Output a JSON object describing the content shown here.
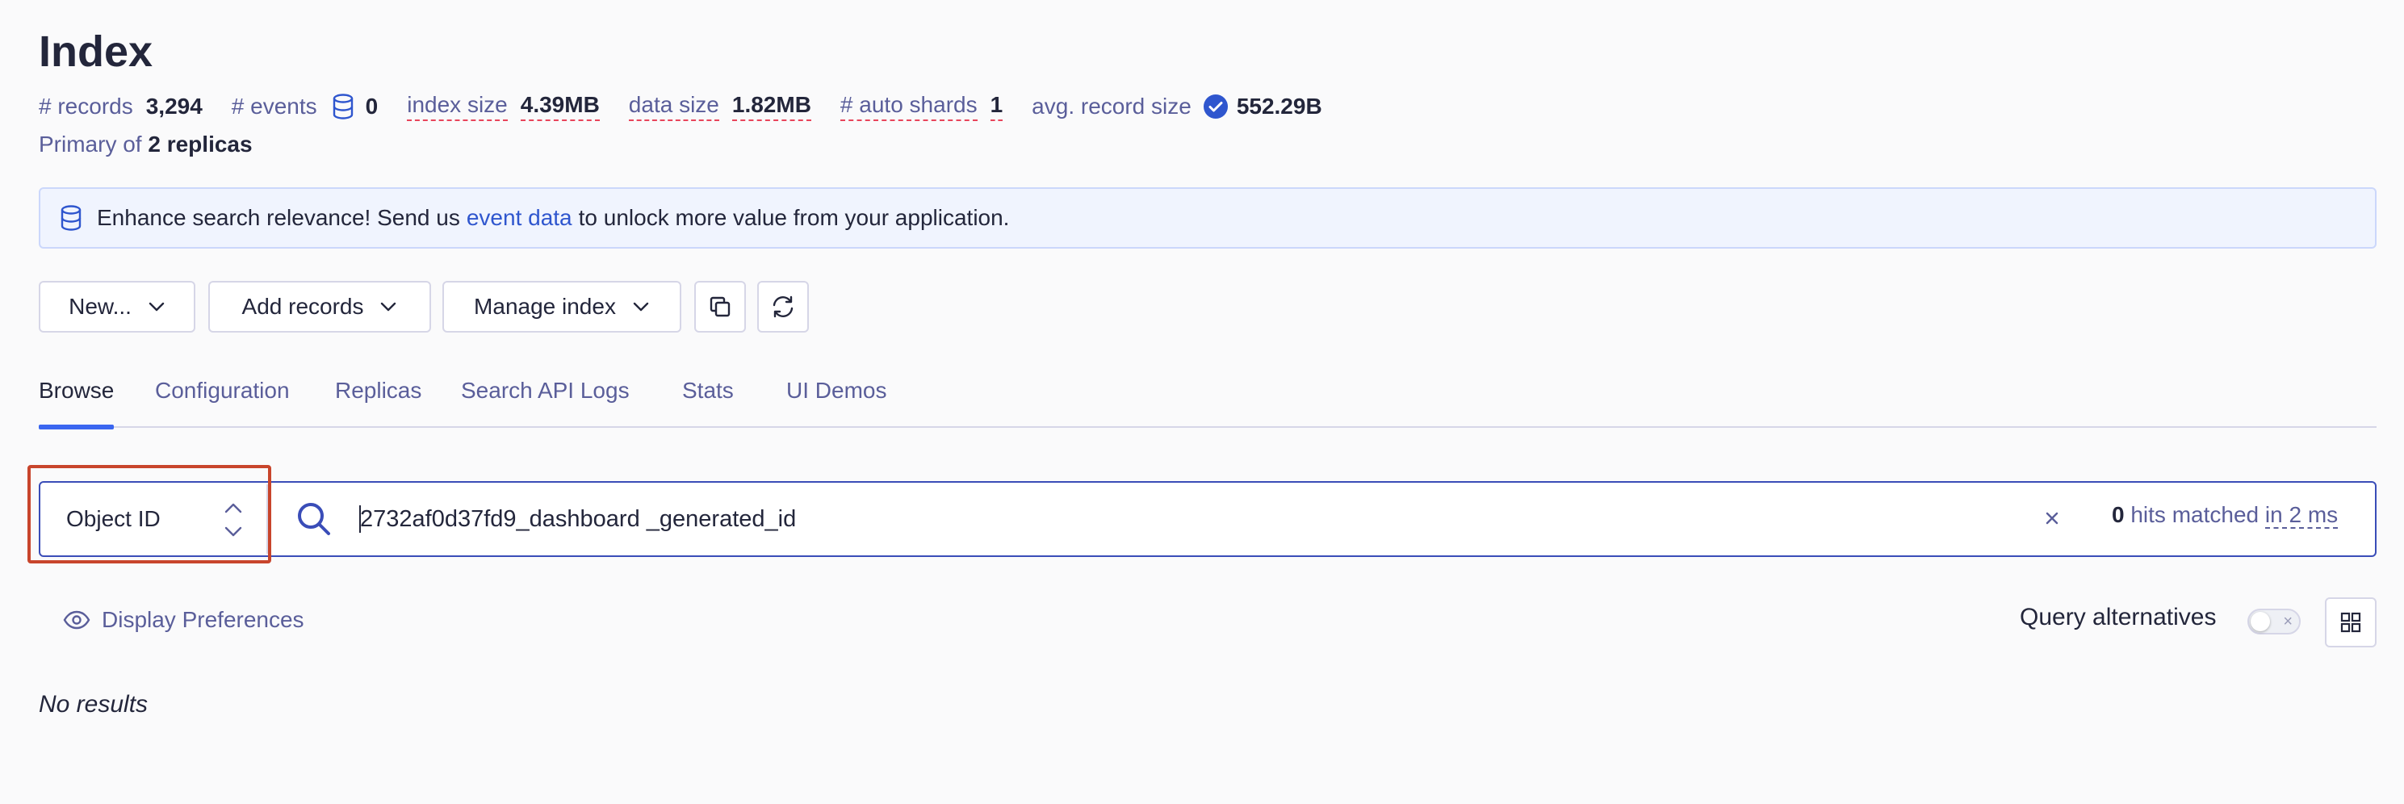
{
  "page": {
    "title": "Index"
  },
  "stats": {
    "records_label": "# records",
    "records_value": "3,294",
    "events_label": "# events",
    "events_value": "0",
    "index_size_label": "index size",
    "index_size_value": "4.39MB",
    "data_size_label": "data size",
    "data_size_value": "1.82MB",
    "auto_shards_label": "# auto shards",
    "auto_shards_value": "1",
    "avg_record_label": "avg. record size",
    "avg_record_value": "552.29B"
  },
  "replicas": {
    "prefix": "Primary of",
    "value": "2 replicas"
  },
  "banner": {
    "text_before": "Enhance search relevance! Send us",
    "link": "event data",
    "text_after": "to unlock more value from your application."
  },
  "toolbar": {
    "new_label": "New...",
    "add_records_label": "Add records",
    "manage_index_label": "Manage index"
  },
  "tabs": [
    {
      "label": "Browse",
      "active": true
    },
    {
      "label": "Configuration"
    },
    {
      "label": "Replicas"
    },
    {
      "label": "Search API Logs"
    },
    {
      "label": "Stats"
    },
    {
      "label": "UI Demos"
    }
  ],
  "search": {
    "attribute_label": "Object ID",
    "query": "2732af0d37fd9_dashboard _generated_id",
    "hits_count": "0",
    "hits_text": "hits matched",
    "timing": "in 2 ms"
  },
  "display_prefs": {
    "label": "Display Preferences"
  },
  "query_alternatives": {
    "label": "Query alternatives",
    "enabled": false
  },
  "results": {
    "empty_text": "No results"
  },
  "colors": {
    "accent": "#3a66f0",
    "link": "#2f56ce",
    "highlight_border": "#c8452c",
    "dashed_underline": "#e8455b"
  }
}
